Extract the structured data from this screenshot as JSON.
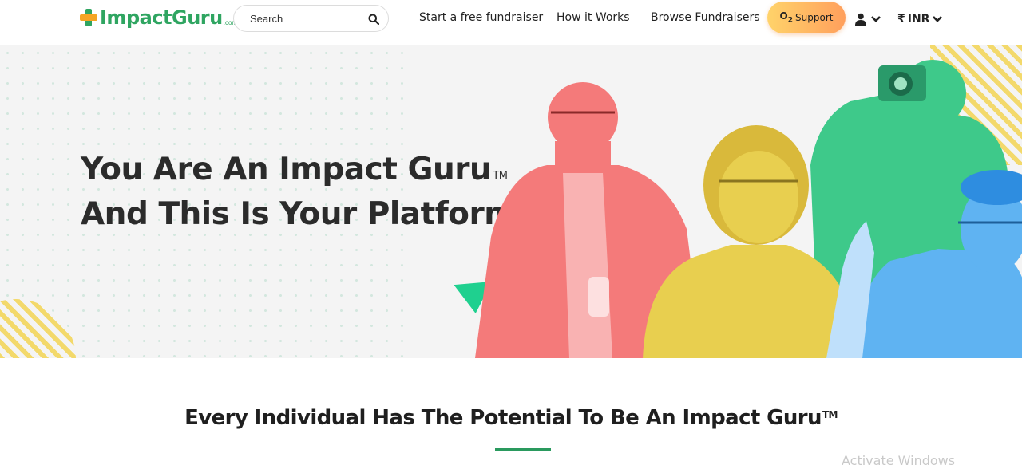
{
  "header": {
    "logo_text": "ImpactGuru",
    "logo_suffix": ".com",
    "search_placeholder": "Search",
    "nav": [
      "Start a free fundraiser",
      "How it Works",
      "Browse Fundraisers"
    ],
    "support_brand": "O2",
    "support_label": "Support",
    "currency_symbol": "₹",
    "currency_code": "INR"
  },
  "hero": {
    "title_line1": "You Are An Impact Guru",
    "title_tm": "TM",
    "title_line2": "And This Is Your Platform"
  },
  "section": {
    "title": "Every Individual Has The Potential To Be An Impact Guru",
    "title_tm": "TM"
  },
  "watermark": "Activate Windows",
  "colors": {
    "brand_green": "#2fa561",
    "brand_orange": "#f5a524",
    "accent_green": "#1fd08f",
    "photo_red": "#f47a7a",
    "photo_yellow": "#e8cf4f",
    "photo_green": "#3ec98a",
    "photo_blue": "#5fb3f2"
  },
  "icons": [
    "search-icon",
    "user-icon",
    "chevron-down-icon",
    "rupee-icon"
  ]
}
